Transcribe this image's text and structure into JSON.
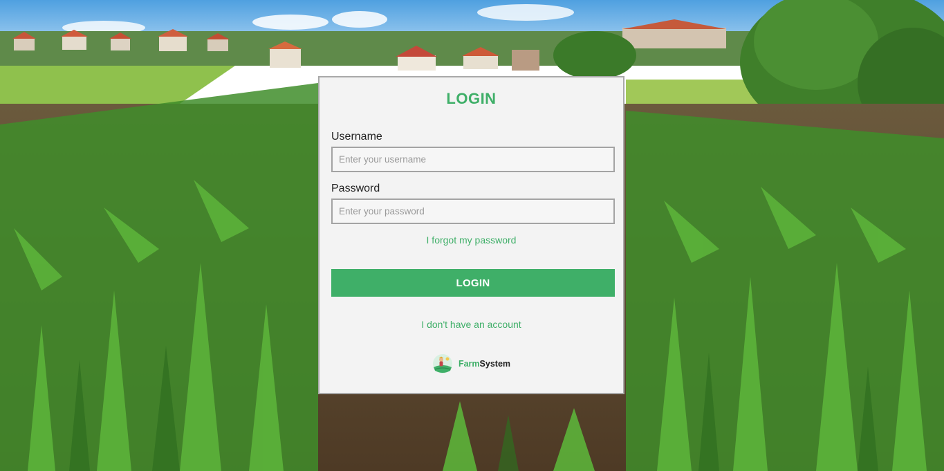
{
  "login": {
    "title": "LOGIN",
    "username_label": "Username",
    "username_placeholder": "Enter your username",
    "password_label": "Password",
    "password_placeholder": "Enter your password",
    "forgot_link": "I forgot my password",
    "submit_label": "LOGIN",
    "signup_link": "I don't have an account"
  },
  "brand": {
    "name_part1": "Farm",
    "name_part2": "System",
    "logo_icon": "farmer-field-logo-icon"
  },
  "colors": {
    "accent": "#3faf68",
    "card_background": "#f3f3f3",
    "card_border": "#a9a9a9"
  }
}
